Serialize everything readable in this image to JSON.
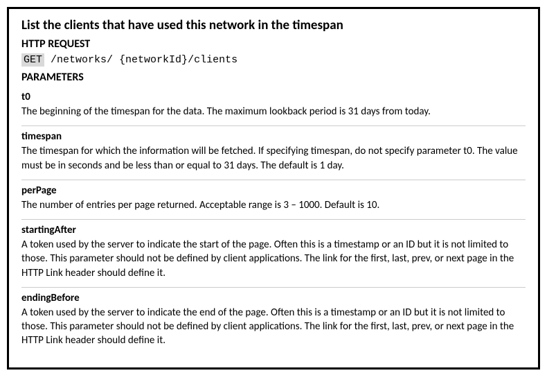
{
  "title": "List the clients that have used this network in the timespan",
  "httpRequestLabel": "HTTP REQUEST",
  "httpMethod": "GET",
  "httpPath": "/networks/ {networkId}/clients",
  "parametersLabel": "PARAMETERS",
  "params": [
    {
      "name": "t0",
      "desc": "The beginning of the timespan for the data. The maximum lookback period is 31 days from today."
    },
    {
      "name": "timespan",
      "desc": "The timespan for which the information will be fetched. If specifying timespan, do not specify parameter t0. The value must be in seconds and be less than or equal to 31 days. The default is 1 day."
    },
    {
      "name": "perPage",
      "desc": "The number of entries per page returned. Acceptable range is 3 – 1000. Default is 10."
    },
    {
      "name": "startingAfter",
      "desc": "A token used by the server to indicate the start of the page. Often this is a timestamp or an ID but it is not limited to those. This parameter should not be defined by client applications. The link for the first, last, prev, or next page in the HTTP Link header should define it."
    },
    {
      "name": "endingBefore",
      "desc": "A token used by the server to indicate the end of the page. Often this is a timestamp or an ID but it is not limited to those. This parameter should not be defined by client applications. The link for the first, last, prev, or next page in the HTTP Link header should define it."
    }
  ]
}
